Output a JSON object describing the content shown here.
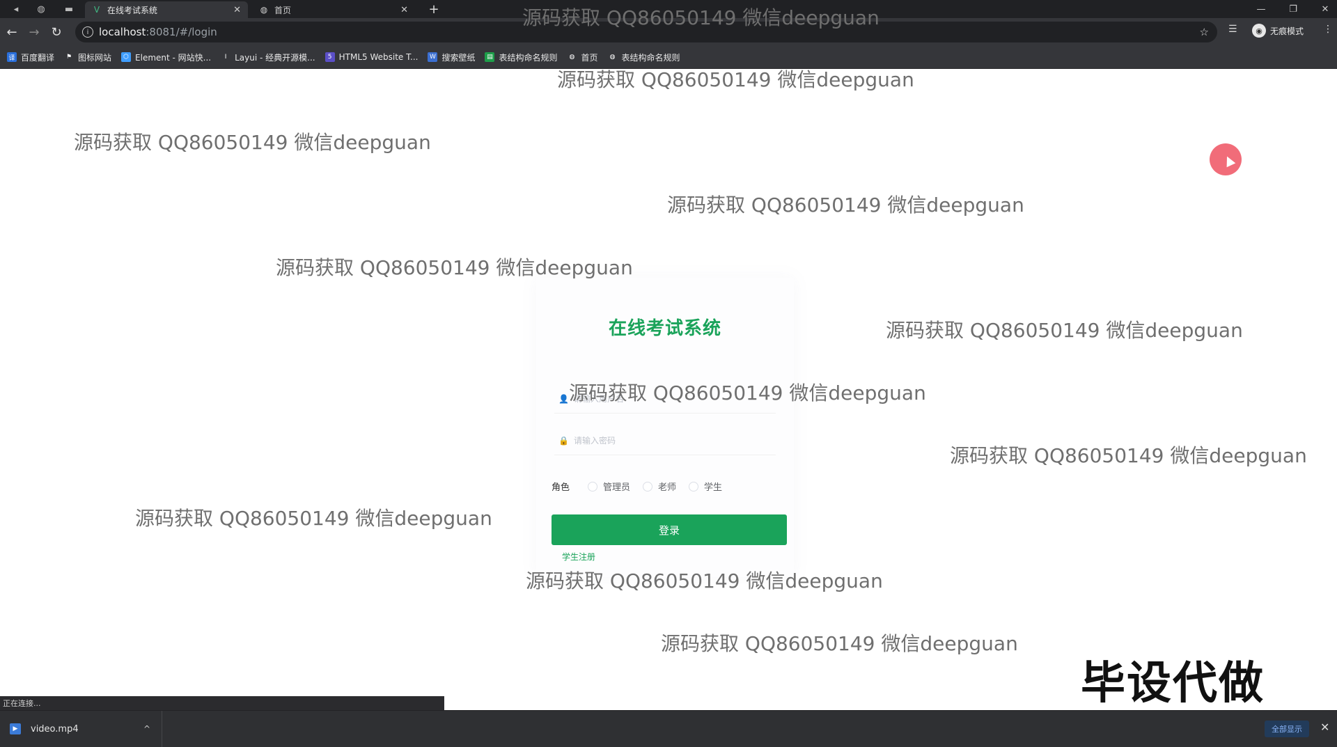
{
  "browser": {
    "tabs": [
      {
        "title": "在线考试系统",
        "icon": "vue-logo-icon",
        "active": true
      },
      {
        "title": "首页",
        "icon": "globe-icon",
        "active": false
      }
    ],
    "url_host": "localhost",
    "url_rest": ":8081/#/login",
    "profile_label": "无痕模式",
    "bookmarks": [
      {
        "label": "百度翻译",
        "icon": "translate-icon",
        "color": "#2a6fdb"
      },
      {
        "label": "图标网站",
        "icon": "flag-icon",
        "color": "#444444"
      },
      {
        "label": "Element - 网站快...",
        "icon": "element-icon",
        "color": "#409eff"
      },
      {
        "label": "Layui - 经典开源模...",
        "icon": "layui-icon",
        "color": "#555555"
      },
      {
        "label": "HTML5 Website T...",
        "icon": "html5-icon",
        "color": "#5b4fc7"
      },
      {
        "label": "搜索壁纸",
        "icon": "wallpaper-icon",
        "color": "#3b6fd1"
      },
      {
        "label": "表结构命名规则",
        "icon": "sheet-icon",
        "color": "#1e9e4a"
      },
      {
        "label": "首页",
        "icon": "globe-icon",
        "color": "#666666"
      },
      {
        "label": "表结构命名规则",
        "icon": "globe-icon",
        "color": "#666666"
      }
    ]
  },
  "login": {
    "title": "在线考试系统",
    "username_placeholder": "请输入用户名",
    "password_placeholder": "请输入密码",
    "role_label": "角色",
    "roles": [
      "管理员",
      "老师",
      "学生"
    ],
    "submit_label": "登录",
    "register_link": "学生注册"
  },
  "watermark_text": "源码获取 QQ86050149 微信deepguan",
  "overlay_title": "毕设代做",
  "status_text": "正在连接...",
  "download": {
    "file_name": "video.mp4",
    "show_all_label": "全部显示"
  },
  "colors": {
    "accent": "#1aa35a",
    "chrome": "#35363a"
  }
}
